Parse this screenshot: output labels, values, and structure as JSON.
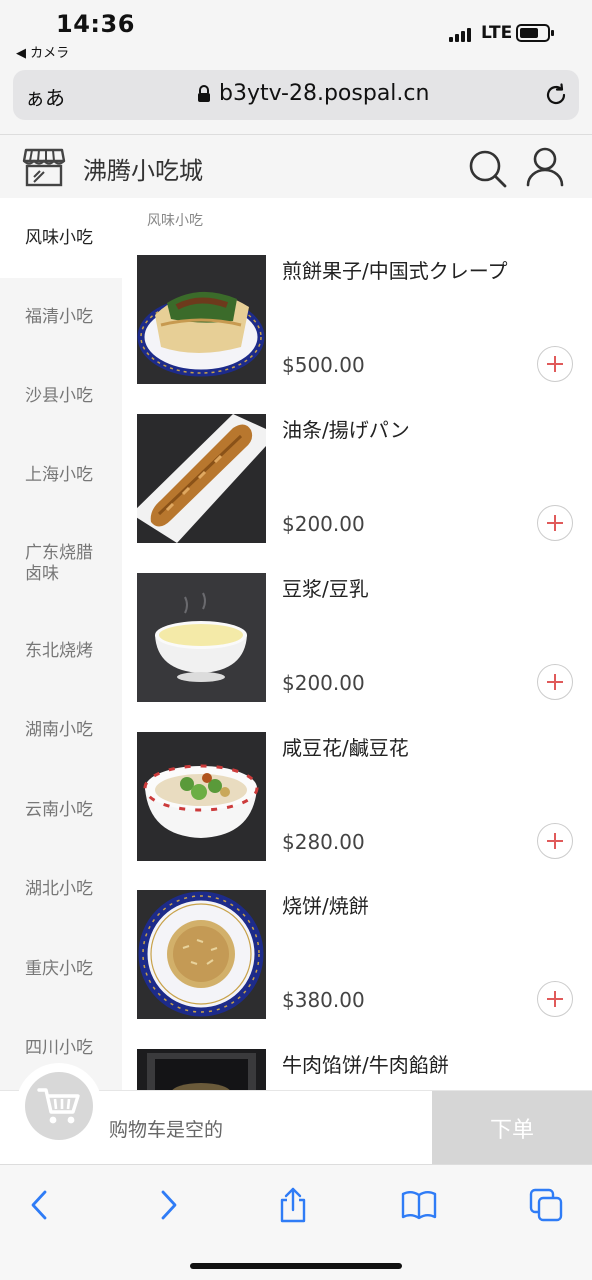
{
  "status_bar": {
    "time": "14:36",
    "back_label": "◀ カメラ",
    "network": "LTE"
  },
  "browser": {
    "aa_label": "ぁあ",
    "url": "b3ytv-28.pospal.cn"
  },
  "header": {
    "title": "沸腾小吃城"
  },
  "sidebar": {
    "items": [
      {
        "label": "风味小吃",
        "active": true
      },
      {
        "label": "福清小吃"
      },
      {
        "label": "沙县小吃"
      },
      {
        "label": "上海小吃"
      },
      {
        "label": "广东烧腊卤味"
      },
      {
        "label": "东北烧烤"
      },
      {
        "label": "湖南小吃"
      },
      {
        "label": "云南小吃"
      },
      {
        "label": "湖北小吃"
      },
      {
        "label": "重庆小吃"
      },
      {
        "label": "四川小吃"
      }
    ]
  },
  "main": {
    "section_title": "风味小吃",
    "products": [
      {
        "name": "煎餅果子/中国式クレープ",
        "price": "$500.00"
      },
      {
        "name": "油条/揚げパン",
        "price": "$200.00"
      },
      {
        "name": "豆浆/豆乳",
        "price": "$200.00"
      },
      {
        "name": "咸豆花/鹹豆花",
        "price": "$280.00"
      },
      {
        "name": "烧饼/焼餅",
        "price": "$380.00"
      },
      {
        "name": "牛肉馅饼/牛肉餡餅",
        "price": ""
      }
    ]
  },
  "cart": {
    "empty_text": "购物车是空的",
    "order_label": "下单"
  },
  "colors": {
    "accent_red": "#e05a5a",
    "disabled_gray": "#d6d6d6",
    "ios_blue": "#2f7cf6"
  }
}
